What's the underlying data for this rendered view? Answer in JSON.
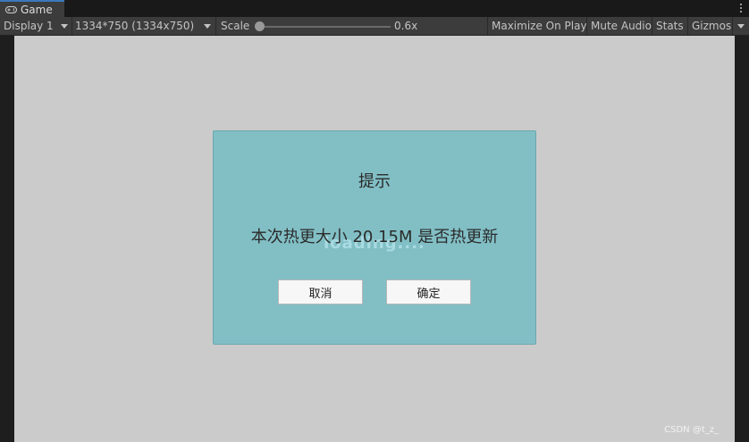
{
  "tab": {
    "label": "Game",
    "icon": "gamepad-icon"
  },
  "toolbar": {
    "display": "Display 1",
    "resolution": "1334*750 (1334x750)",
    "scale_label": "Scale",
    "scale_value": "0.6x",
    "scale_fraction": 0.0,
    "maximize": "Maximize On Play",
    "mute": "Mute Audio",
    "stats": "Stats",
    "gizmos": "Gizmos"
  },
  "dialog": {
    "title": "提示",
    "message": "本次热更大小 20.15M 是否热更新",
    "background_text": "loading....",
    "cancel_label": "取消",
    "ok_label": "确定",
    "background_color": "#81bfc5"
  },
  "watermark": "CSDN @t_z_"
}
